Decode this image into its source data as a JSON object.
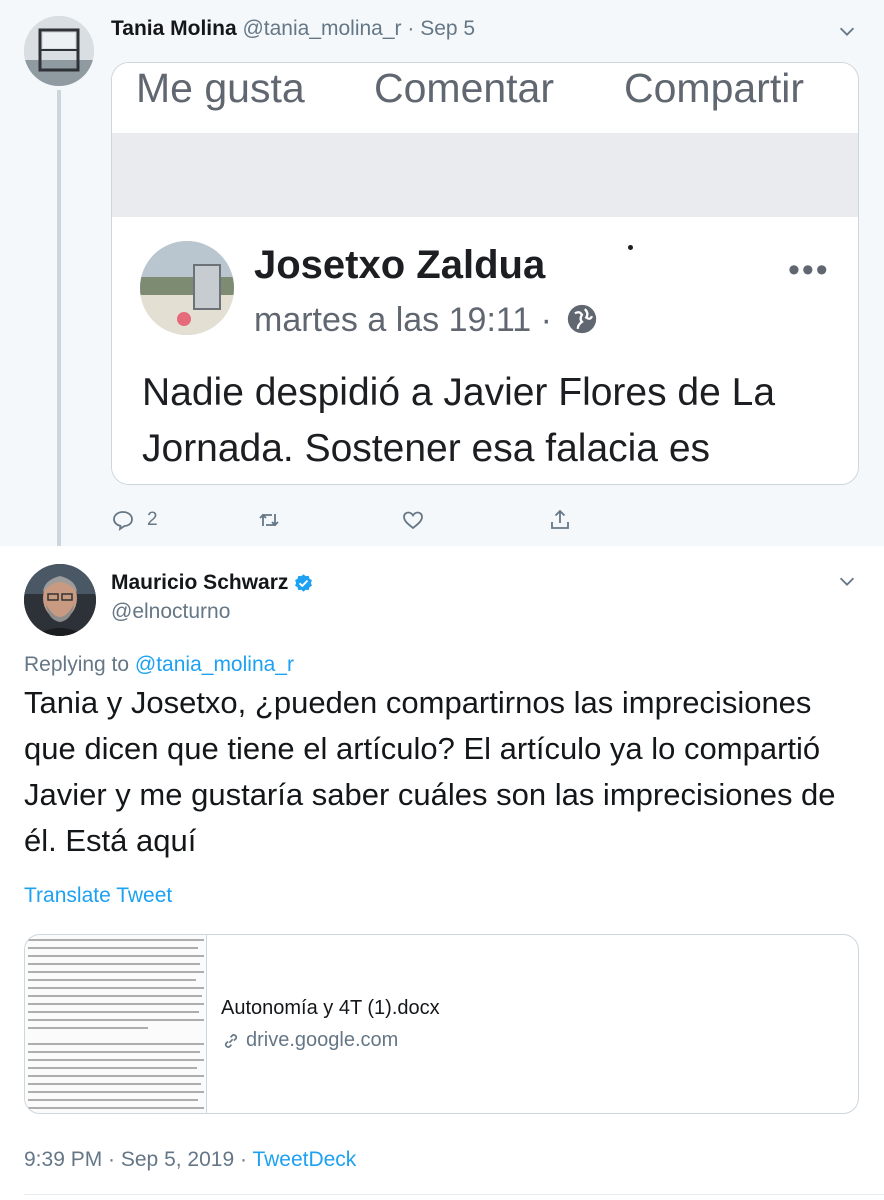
{
  "reply_tweet": {
    "author_name": "Tania Molina",
    "author_handle": "@tania_molina_r",
    "separator": "·",
    "date": "Sep 5",
    "embedded_screenshot": {
      "actions": [
        "Me gusta",
        "Comentar",
        "Compartir"
      ],
      "post_author": "Josetxo Zaldua",
      "post_time": "martes a las 19:11 ·",
      "more_icon": "•••",
      "post_text": "Nadie despidió a Javier Flores de La Jornada. Sostener esa falacia es envenenar. Javier Flores"
    },
    "reply_count": "2",
    "icons": [
      "reply-icon",
      "retweet-icon",
      "like-icon",
      "share-icon",
      "chevron-down-icon",
      "globe-icon"
    ]
  },
  "main_tweet": {
    "author_name": "Mauricio Schwarz",
    "author_handle": "@elnocturno",
    "verified": true,
    "replying_prefix": "Replying to",
    "replying_to": "@tania_molina_r",
    "text": "Tania y Josetxo, ¿pueden compartirnos las imprecisiones que dicen que tiene el artículo? El artículo ya lo compartió Javier y me gustaría saber cuáles son las imprecisiones de él. Está aquí",
    "translate_label": "Translate Tweet",
    "card": {
      "title": "Autonomía y 4T (1).docx",
      "domain": "drive.google.com"
    },
    "timestamp": "9:39 PM · Sep 5, 2019 ·",
    "source": "TweetDeck"
  },
  "colors": {
    "link_blue": "#1da1f2",
    "secondary_text": "#657786",
    "thread_background": "#f5f8fa"
  }
}
